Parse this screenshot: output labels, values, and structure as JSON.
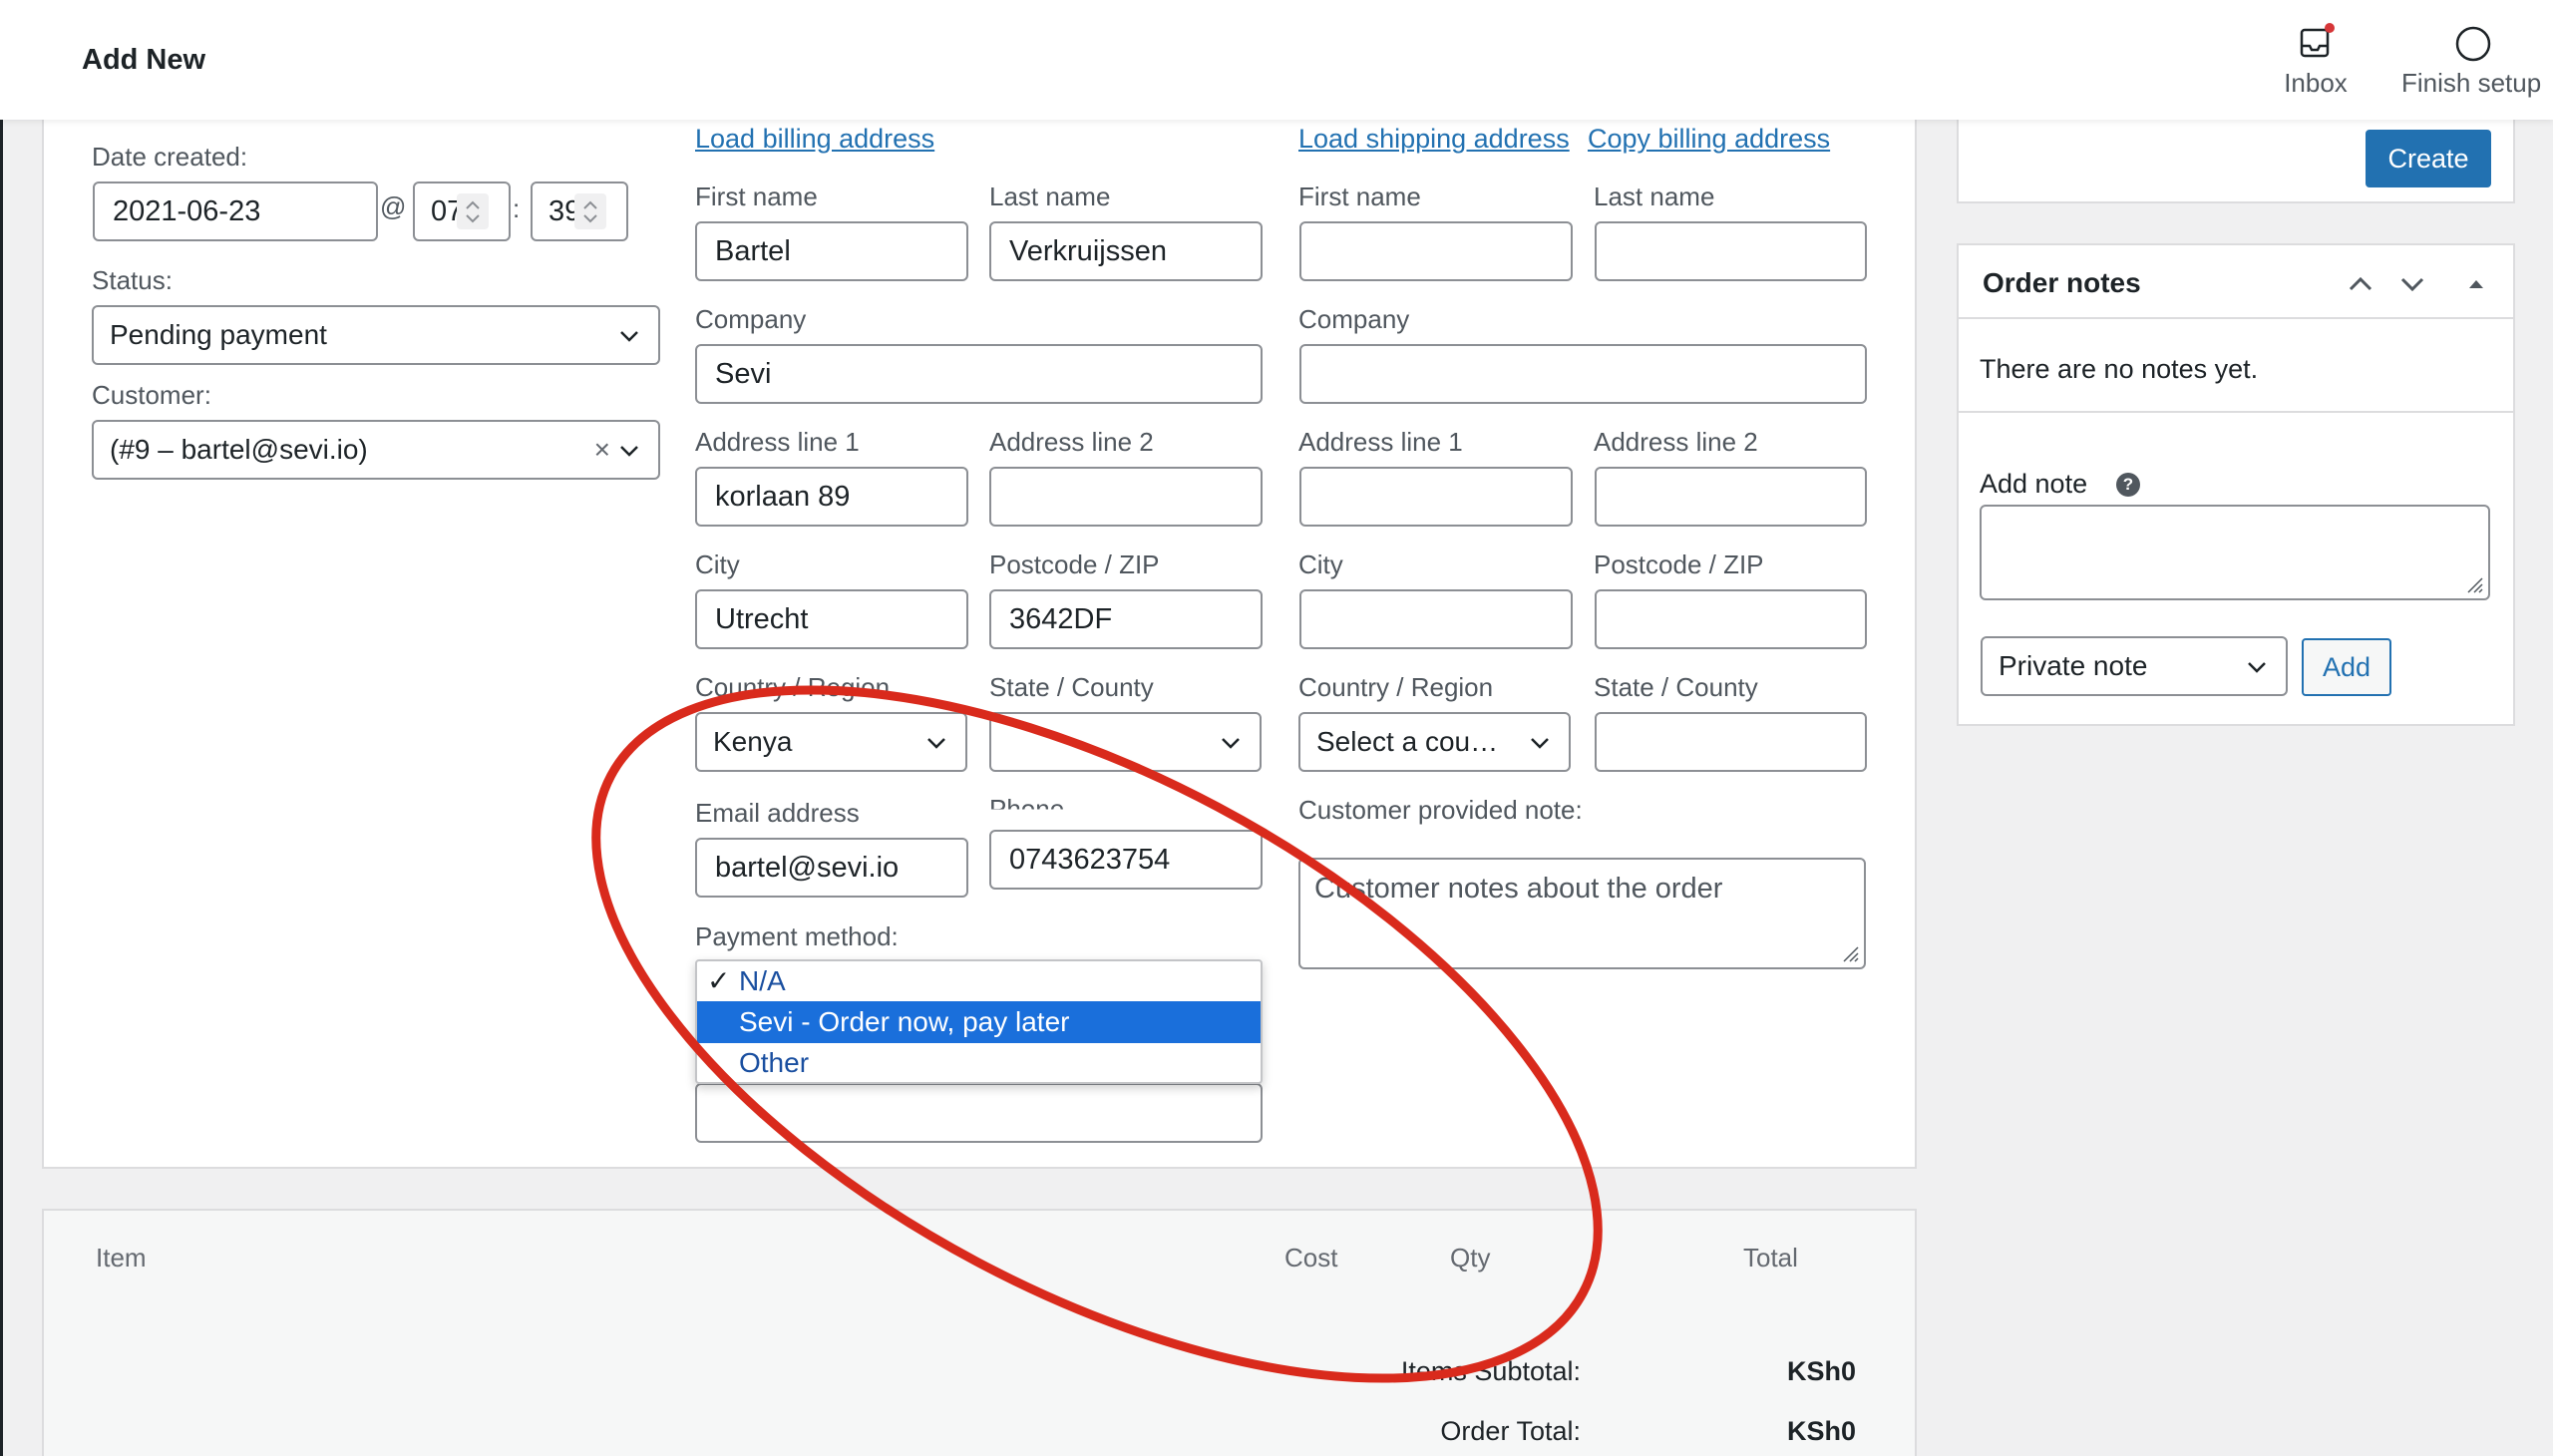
{
  "header": {
    "title": "Add New",
    "inbox_label": "Inbox",
    "finish_setup_label": "Finish setup"
  },
  "general": {
    "date_label": "Date created:",
    "date_value": "2021-06-23",
    "at_sign": "@",
    "hour": "07",
    "colon": ":",
    "minute": "39",
    "status_label": "Status:",
    "status_value": "Pending payment",
    "customer_label": "Customer:",
    "customer_value": "(#9 – bartel@sevi.io)",
    "clear_glyph": "×"
  },
  "billing": {
    "load_link": "Load billing address",
    "first_name_label": "First name",
    "first_name": "Bartel",
    "last_name_label": "Last name",
    "last_name": "Verkruijssen",
    "company_label": "Company",
    "company": "Sevi",
    "address1_label": "Address line 1",
    "address1": "korlaan 89",
    "address2_label": "Address line 2",
    "address2": "",
    "city_label": "City",
    "city": "Utrecht",
    "postcode_label": "Postcode / ZIP",
    "postcode": "3642DF",
    "country_label": "Country / Region",
    "country": "Kenya",
    "state_label": "State / County",
    "state": "",
    "email_label": "Email address",
    "email": "bartel@sevi.io",
    "phone_label": "Phone",
    "phone": "0743623754",
    "payment_label": "Payment method:",
    "payment_options": {
      "selected_check": "✓",
      "na": "N/A",
      "sevi": "Sevi - Order now, pay later",
      "other": "Other"
    }
  },
  "shipping": {
    "load_link": "Load shipping address",
    "copy_link": "Copy billing address",
    "first_name_label": "First name",
    "last_name_label": "Last name",
    "company_label": "Company",
    "address1_label": "Address line 1",
    "address2_label": "Address line 2",
    "city_label": "City",
    "postcode_label": "Postcode / ZIP",
    "country_label": "Country / Region",
    "country_placeholder": "Select a count…",
    "state_label": "State / County",
    "note_label": "Customer provided note:",
    "note_placeholder": "Customer notes about the order"
  },
  "actions": {
    "create_label": "Create"
  },
  "order_notes": {
    "title": "Order notes",
    "empty_text": "There are no notes yet.",
    "add_note_label": "Add note",
    "help_glyph": "?",
    "note_type": "Private note",
    "add_button": "Add"
  },
  "items": {
    "col_item": "Item",
    "col_cost": "Cost",
    "col_qty": "Qty",
    "col_total": "Total",
    "subtotal_label": "Items Subtotal:",
    "subtotal_value": "KSh0",
    "order_total_label": "Order Total:",
    "order_total_value": "KSh0"
  },
  "colors": {
    "accent": "#2271b1",
    "highlight": "#1a6fdb",
    "annotation": "#d92a1c",
    "notification_dot": "#d63638"
  }
}
